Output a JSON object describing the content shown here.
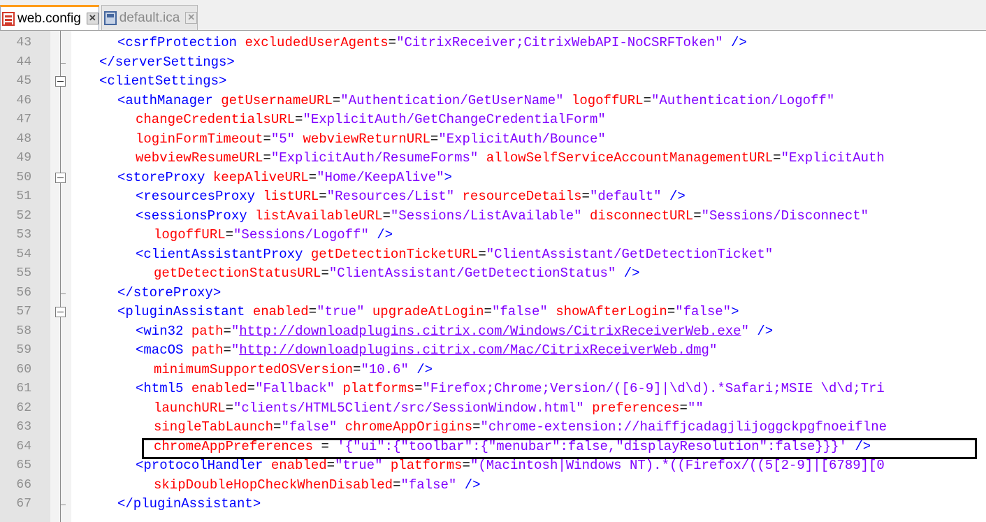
{
  "tabs": [
    {
      "label": "web.config",
      "icon": "xml-file-icon",
      "active": true
    },
    {
      "label": "default.ica",
      "icon": "ica-file-icon",
      "active": false
    }
  ],
  "lines": [
    {
      "num": "43",
      "fold": "line",
      "segs": [
        {
          "text": "<csrfProtection",
          "cls": "t"
        },
        {
          "text": " "
        },
        {
          "text": "excludedUserAgents",
          "cls": "a"
        },
        {
          "text": "=",
          "cls": "p"
        },
        {
          "text": "\"CitrixReceiver;CitrixWebAPI-NoCSRFToken\"",
          "cls": "v"
        },
        {
          "text": " "
        },
        {
          "text": "/>",
          "cls": "t"
        }
      ]
    },
    {
      "num": "44",
      "fold": "end",
      "segs": [
        {
          "text": "</serverSettings>",
          "cls": "t"
        }
      ]
    },
    {
      "num": "45",
      "fold": "box",
      "segs": [
        {
          "text": "<clientSettings>",
          "cls": "t"
        }
      ]
    },
    {
      "num": "46",
      "fold": "line",
      "segs": [
        {
          "text": "<authManager",
          "cls": "t"
        },
        {
          "text": " "
        },
        {
          "text": "getUsernameURL",
          "cls": "a"
        },
        {
          "text": "=",
          "cls": "p"
        },
        {
          "text": "\"Authentication/GetUserName\"",
          "cls": "v"
        },
        {
          "text": " "
        },
        {
          "text": "logoffURL",
          "cls": "a"
        },
        {
          "text": "=",
          "cls": "p"
        },
        {
          "text": "\"Authentication/Logoff\"",
          "cls": "v"
        }
      ]
    },
    {
      "num": "47",
      "fold": "line",
      "segs": [
        {
          "text": "changeCredentialsURL",
          "cls": "a"
        },
        {
          "text": "=",
          "cls": "p"
        },
        {
          "text": "\"ExplicitAuth/GetChangeCredentialForm\"",
          "cls": "v"
        }
      ]
    },
    {
      "num": "48",
      "fold": "line",
      "segs": [
        {
          "text": "loginFormTimeout",
          "cls": "a"
        },
        {
          "text": "=",
          "cls": "p"
        },
        {
          "text": "\"5\"",
          "cls": "v"
        },
        {
          "text": " "
        },
        {
          "text": "webviewReturnURL",
          "cls": "a"
        },
        {
          "text": "=",
          "cls": "p"
        },
        {
          "text": "\"ExplicitAuth/Bounce\"",
          "cls": "v"
        }
      ]
    },
    {
      "num": "49",
      "fold": "line",
      "segs": [
        {
          "text": "webviewResumeURL",
          "cls": "a"
        },
        {
          "text": "=",
          "cls": "p"
        },
        {
          "text": "\"ExplicitAuth/ResumeForms\"",
          "cls": "v"
        },
        {
          "text": " "
        },
        {
          "text": "allowSelfServiceAccountManagementURL",
          "cls": "a"
        },
        {
          "text": "=",
          "cls": "p"
        },
        {
          "text": "\"ExplicitAuth",
          "cls": "v"
        }
      ]
    },
    {
      "num": "50",
      "fold": "box",
      "segs": [
        {
          "text": "<storeProxy",
          "cls": "t"
        },
        {
          "text": " "
        },
        {
          "text": "keepAliveURL",
          "cls": "a"
        },
        {
          "text": "=",
          "cls": "p"
        },
        {
          "text": "\"Home/KeepAlive\"",
          "cls": "v"
        },
        {
          "text": ">",
          "cls": "t"
        }
      ]
    },
    {
      "num": "51",
      "fold": "line",
      "segs": [
        {
          "text": "<resourcesProxy",
          "cls": "t"
        },
        {
          "text": " "
        },
        {
          "text": "listURL",
          "cls": "a"
        },
        {
          "text": "=",
          "cls": "p"
        },
        {
          "text": "\"Resources/List\"",
          "cls": "v"
        },
        {
          "text": " "
        },
        {
          "text": "resourceDetails",
          "cls": "a"
        },
        {
          "text": "=",
          "cls": "p"
        },
        {
          "text": "\"default\"",
          "cls": "v"
        },
        {
          "text": " "
        },
        {
          "text": "/>",
          "cls": "t"
        }
      ]
    },
    {
      "num": "52",
      "fold": "line",
      "segs": [
        {
          "text": "<sessionsProxy",
          "cls": "t"
        },
        {
          "text": " "
        },
        {
          "text": "listAvailableURL",
          "cls": "a"
        },
        {
          "text": "=",
          "cls": "p"
        },
        {
          "text": "\"Sessions/ListAvailable\"",
          "cls": "v"
        },
        {
          "text": " "
        },
        {
          "text": "disconnectURL",
          "cls": "a"
        },
        {
          "text": "=",
          "cls": "p"
        },
        {
          "text": "\"Sessions/Disconnect\"",
          "cls": "v"
        }
      ]
    },
    {
      "num": "53",
      "fold": "line",
      "segs": [
        {
          "text": "logoffURL",
          "cls": "a"
        },
        {
          "text": "=",
          "cls": "p"
        },
        {
          "text": "\"Sessions/Logoff\"",
          "cls": "v"
        },
        {
          "text": " "
        },
        {
          "text": "/>",
          "cls": "t"
        }
      ]
    },
    {
      "num": "54",
      "fold": "line",
      "segs": [
        {
          "text": "<clientAssistantProxy",
          "cls": "t"
        },
        {
          "text": " "
        },
        {
          "text": "getDetectionTicketURL",
          "cls": "a"
        },
        {
          "text": "=",
          "cls": "p"
        },
        {
          "text": "\"ClientAssistant/GetDetectionTicket\"",
          "cls": "v"
        }
      ]
    },
    {
      "num": "55",
      "fold": "line",
      "segs": [
        {
          "text": "getDetectionStatusURL",
          "cls": "a"
        },
        {
          "text": "=",
          "cls": "p"
        },
        {
          "text": "\"ClientAssistant/GetDetectionStatus\"",
          "cls": "v"
        },
        {
          "text": " "
        },
        {
          "text": "/>",
          "cls": "t"
        }
      ]
    },
    {
      "num": "56",
      "fold": "end",
      "segs": [
        {
          "text": "</storeProxy>",
          "cls": "t"
        }
      ]
    },
    {
      "num": "57",
      "fold": "box",
      "segs": [
        {
          "text": "<pluginAssistant",
          "cls": "t"
        },
        {
          "text": " "
        },
        {
          "text": "enabled",
          "cls": "a"
        },
        {
          "text": "=",
          "cls": "p"
        },
        {
          "text": "\"true\"",
          "cls": "v"
        },
        {
          "text": " "
        },
        {
          "text": "upgradeAtLogin",
          "cls": "a"
        },
        {
          "text": "=",
          "cls": "p"
        },
        {
          "text": "\"false\"",
          "cls": "v"
        },
        {
          "text": " "
        },
        {
          "text": "showAfterLogin",
          "cls": "a"
        },
        {
          "text": "=",
          "cls": "p"
        },
        {
          "text": "\"false\"",
          "cls": "v"
        },
        {
          "text": ">",
          "cls": "t"
        }
      ]
    },
    {
      "num": "58",
      "fold": "line",
      "segs": [
        {
          "text": "<win32",
          "cls": "t"
        },
        {
          "text": " "
        },
        {
          "text": "path",
          "cls": "a"
        },
        {
          "text": "=",
          "cls": "p"
        },
        {
          "text": "\"",
          "cls": "v"
        },
        {
          "text": "http://downloadplugins.citrix.com/Windows/CitrixReceiverWeb.exe",
          "cls": "v u"
        },
        {
          "text": "\"",
          "cls": "v"
        },
        {
          "text": " "
        },
        {
          "text": "/>",
          "cls": "t"
        }
      ]
    },
    {
      "num": "59",
      "fold": "line",
      "segs": [
        {
          "text": "<macOS",
          "cls": "t"
        },
        {
          "text": " "
        },
        {
          "text": "path",
          "cls": "a"
        },
        {
          "text": "=",
          "cls": "p"
        },
        {
          "text": "\"",
          "cls": "v"
        },
        {
          "text": "http://downloadplugins.citrix.com/Mac/CitrixReceiverWeb.dmg",
          "cls": "v u"
        },
        {
          "text": "\"",
          "cls": "v"
        }
      ]
    },
    {
      "num": "60",
      "fold": "line",
      "segs": [
        {
          "text": "minimumSupportedOSVersion",
          "cls": "a"
        },
        {
          "text": "=",
          "cls": "p"
        },
        {
          "text": "\"10.6\"",
          "cls": "v"
        },
        {
          "text": " "
        },
        {
          "text": "/>",
          "cls": "t"
        }
      ]
    },
    {
      "num": "61",
      "fold": "line",
      "segs": [
        {
          "text": "<html5",
          "cls": "t"
        },
        {
          "text": " "
        },
        {
          "text": "enabled",
          "cls": "a"
        },
        {
          "text": "=",
          "cls": "p"
        },
        {
          "text": "\"Fallback\"",
          "cls": "v"
        },
        {
          "text": " "
        },
        {
          "text": "platforms",
          "cls": "a"
        },
        {
          "text": "=",
          "cls": "p"
        },
        {
          "text": "\"Firefox;Chrome;Version/([6-9]|\\d\\d).*Safari;MSIE \\d\\d;Tri",
          "cls": "v"
        }
      ]
    },
    {
      "num": "62",
      "fold": "line",
      "segs": [
        {
          "text": "launchURL",
          "cls": "a"
        },
        {
          "text": "=",
          "cls": "p"
        },
        {
          "text": "\"clients/HTML5Client/src/SessionWindow.html\"",
          "cls": "v"
        },
        {
          "text": " "
        },
        {
          "text": "preferences",
          "cls": "a"
        },
        {
          "text": "=",
          "cls": "p"
        },
        {
          "text": "\"\"",
          "cls": "v"
        }
      ]
    },
    {
      "num": "63",
      "fold": "line",
      "segs": [
        {
          "text": "singleTabLaunch",
          "cls": "a"
        },
        {
          "text": "=",
          "cls": "p"
        },
        {
          "text": "\"false\"",
          "cls": "v"
        },
        {
          "text": " "
        },
        {
          "text": "chromeAppOrigins",
          "cls": "a"
        },
        {
          "text": "=",
          "cls": "p"
        },
        {
          "text": "\"chrome-extension://haiffjcadagjlijoggckpgfnoeiflne",
          "cls": "v"
        }
      ]
    },
    {
      "num": "64",
      "fold": "line",
      "segs": [
        {
          "text": "chromeAppPreferences",
          "cls": "a"
        },
        {
          "text": " = ",
          "cls": "p"
        },
        {
          "text": "'{\"ui\":{\"toolbar\":{\"menubar\":false,\"displayResolution\":false}}}'",
          "cls": "v"
        },
        {
          "text": " "
        },
        {
          "text": "/>",
          "cls": "t"
        }
      ]
    },
    {
      "num": "65",
      "fold": "line",
      "segs": [
        {
          "text": "<protocolHandler",
          "cls": "t"
        },
        {
          "text": " "
        },
        {
          "text": "enabled",
          "cls": "a"
        },
        {
          "text": "=",
          "cls": "p"
        },
        {
          "text": "\"true\"",
          "cls": "v"
        },
        {
          "text": " "
        },
        {
          "text": "platforms",
          "cls": "a"
        },
        {
          "text": "=",
          "cls": "p"
        },
        {
          "text": "\"(Macintosh|Windows NT).*((Firefox/((5[2-9]|[6789][0",
          "cls": "v"
        }
      ]
    },
    {
      "num": "66",
      "fold": "line",
      "segs": [
        {
          "text": "skipDoubleHopCheckWhenDisabled",
          "cls": "a"
        },
        {
          "text": "=",
          "cls": "p"
        },
        {
          "text": "\"false\"",
          "cls": "v"
        },
        {
          "text": " "
        },
        {
          "text": "/>",
          "cls": "t"
        }
      ]
    },
    {
      "num": "67",
      "fold": "end",
      "segs": [
        {
          "text": "</pluginAssistant>",
          "cls": "t"
        }
      ]
    }
  ],
  "colors": {
    "tag": "#0000ff",
    "attribute": "#ff0000",
    "value": "#8000ff",
    "line_number": "#909090",
    "active_tab_accent": "#ff9c1a"
  },
  "highlight": {
    "line": "64"
  }
}
